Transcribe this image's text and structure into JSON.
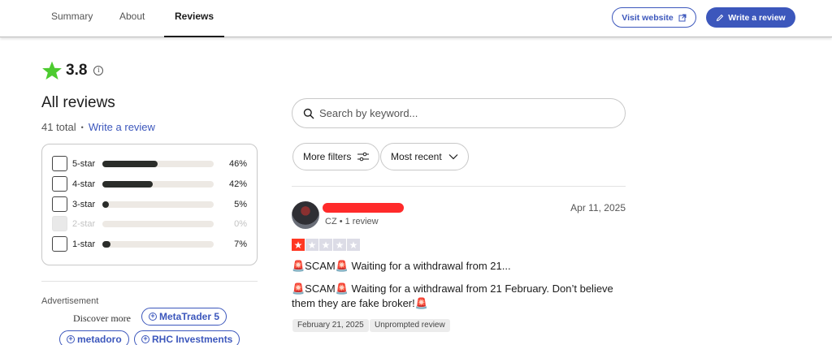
{
  "nav": {
    "tabs": [
      {
        "label": "Summary"
      },
      {
        "label": "About"
      },
      {
        "label": "Reviews"
      }
    ],
    "visit_label": "Visit website",
    "write_label": "Write a review"
  },
  "summary": {
    "rating": "3.8",
    "heading": "All reviews",
    "total": "41 total",
    "separator": "•",
    "write_link": "Write a review"
  },
  "distribution": [
    {
      "label": "5-star",
      "pct": "46%",
      "fraction": 0.46,
      "enabled": true
    },
    {
      "label": "4-star",
      "pct": "42%",
      "fraction": 0.42,
      "enabled": true
    },
    {
      "label": "3-star",
      "pct": "5%",
      "fraction": 0.05,
      "enabled": true
    },
    {
      "label": "2-star",
      "pct": "0%",
      "fraction": 0.0,
      "enabled": false
    },
    {
      "label": "1-star",
      "pct": "7%",
      "fraction": 0.07,
      "enabled": true
    }
  ],
  "advertisement": {
    "label": "Advertisement",
    "discover_text": "Discover more",
    "chips": [
      "MetaTrader 5",
      "metadoro",
      "RHC Investments"
    ]
  },
  "search": {
    "placeholder": "Search by keyword..."
  },
  "filters": {
    "more_label": "More filters",
    "sort_label": "Most recent"
  },
  "review": {
    "meta": "CZ • 1 review",
    "date": "Apr 11, 2025",
    "stars": 1,
    "title": "🚨SCAM🚨 Waiting for a withdrawal from 21...",
    "body": "🚨SCAM🚨 Waiting for a withdrawal from 21 February. Don’t believe them they are fake broker!🚨",
    "tags": [
      "February 21, 2025",
      "Unprompted review"
    ]
  },
  "colors": {
    "accent": "#3c57bc",
    "star_green": "#00b67a",
    "star_red": "#ff3722",
    "bar_fill": "#2b2d2a"
  }
}
